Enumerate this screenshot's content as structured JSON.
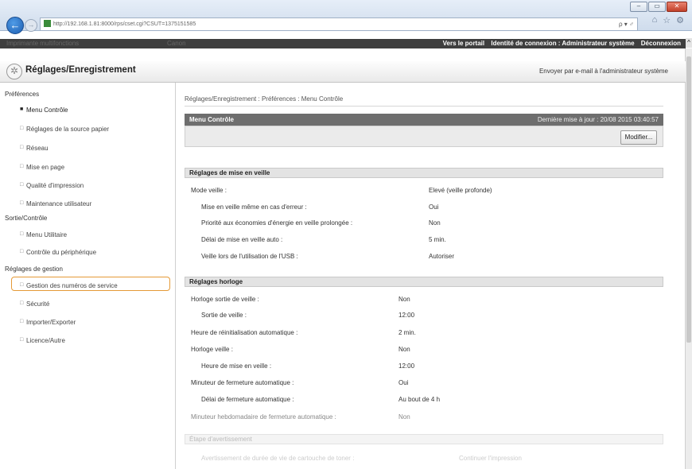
{
  "browser": {
    "url": "http://192.168.1.81:8000/rps/cset.cgi?CSUT=1375151585",
    "search_controls": "ρ ▾ ♂"
  },
  "navbar": {
    "blurred_left": "Imprimante multifonctions",
    "blurred_mid": "Canon",
    "links": [
      "Vers le portail",
      "Identité de connexion : Administrateur système",
      "Déconnexion"
    ]
  },
  "header": {
    "title": "Réglages/Enregistrement",
    "email_link": "Envoyer par e-mail à l'administrateur système"
  },
  "sidebar": {
    "sections": [
      {
        "label": "Préférences",
        "items": [
          "Menu Contrôle",
          "Réglages de la source papier",
          "Réseau",
          "Mise en page",
          "Qualité d'impression",
          "Maintenance utilisateur"
        ]
      },
      {
        "label": "Sortie/Contrôle",
        "items": [
          "Menu Utilitaire",
          "Contrôle du périphérique"
        ]
      },
      {
        "label": "Réglages de gestion",
        "items": [
          "Gestion des numéros de service",
          "Sécurité",
          "Importer/Exporter",
          "Licence/Autre"
        ]
      }
    ]
  },
  "main": {
    "breadcrumb": "Réglages/Enregistrement : Préférences : Menu Contrôle",
    "panel_title": "Menu Contrôle",
    "last_update": "Dernière mise à jour : 20/08 2015 03:40:57",
    "edit_button": "Modifier...",
    "sleep": {
      "header": "Réglages de mise en veille",
      "rows": [
        {
          "label": "Mode veille :",
          "value": "Elevé (veille profonde)"
        },
        {
          "label": "Mise en veille même en cas d'erreur :",
          "value": "Oui"
        },
        {
          "label": "Priorité aux économies d'énergie en veille prolongée :",
          "value": "Non"
        },
        {
          "label": "Délai de mise en veille auto :",
          "value": "5 min."
        },
        {
          "label": "Veille lors de l'utilisation de l'USB :",
          "value": "Autoriser"
        }
      ]
    },
    "clock": {
      "header": "Réglages horloge",
      "rows": [
        {
          "label": "Horloge sortie de veille :",
          "value": "Non"
        },
        {
          "label": "Sortie de veille :",
          "value": "12:00"
        },
        {
          "label": "Heure de réinitialisation automatique :",
          "value": "2 min."
        },
        {
          "label": "Horloge veille :",
          "value": "Non"
        },
        {
          "label": "Heure de mise en veille :",
          "value": "12:00"
        },
        {
          "label": "Minuteur de fermeture automatique :",
          "value": "Oui"
        },
        {
          "label": "Délai de fermeture automatique :",
          "value": "Au bout de 4 h"
        },
        {
          "label": "Minuteur hebdomadaire de fermeture automatique :",
          "value": "Non"
        }
      ]
    },
    "warning": {
      "header": "Étape d'avertissement",
      "row_label": "Avertissement de durée de vie de cartouche de toner :",
      "row_value": "Continuer l'impression"
    }
  }
}
